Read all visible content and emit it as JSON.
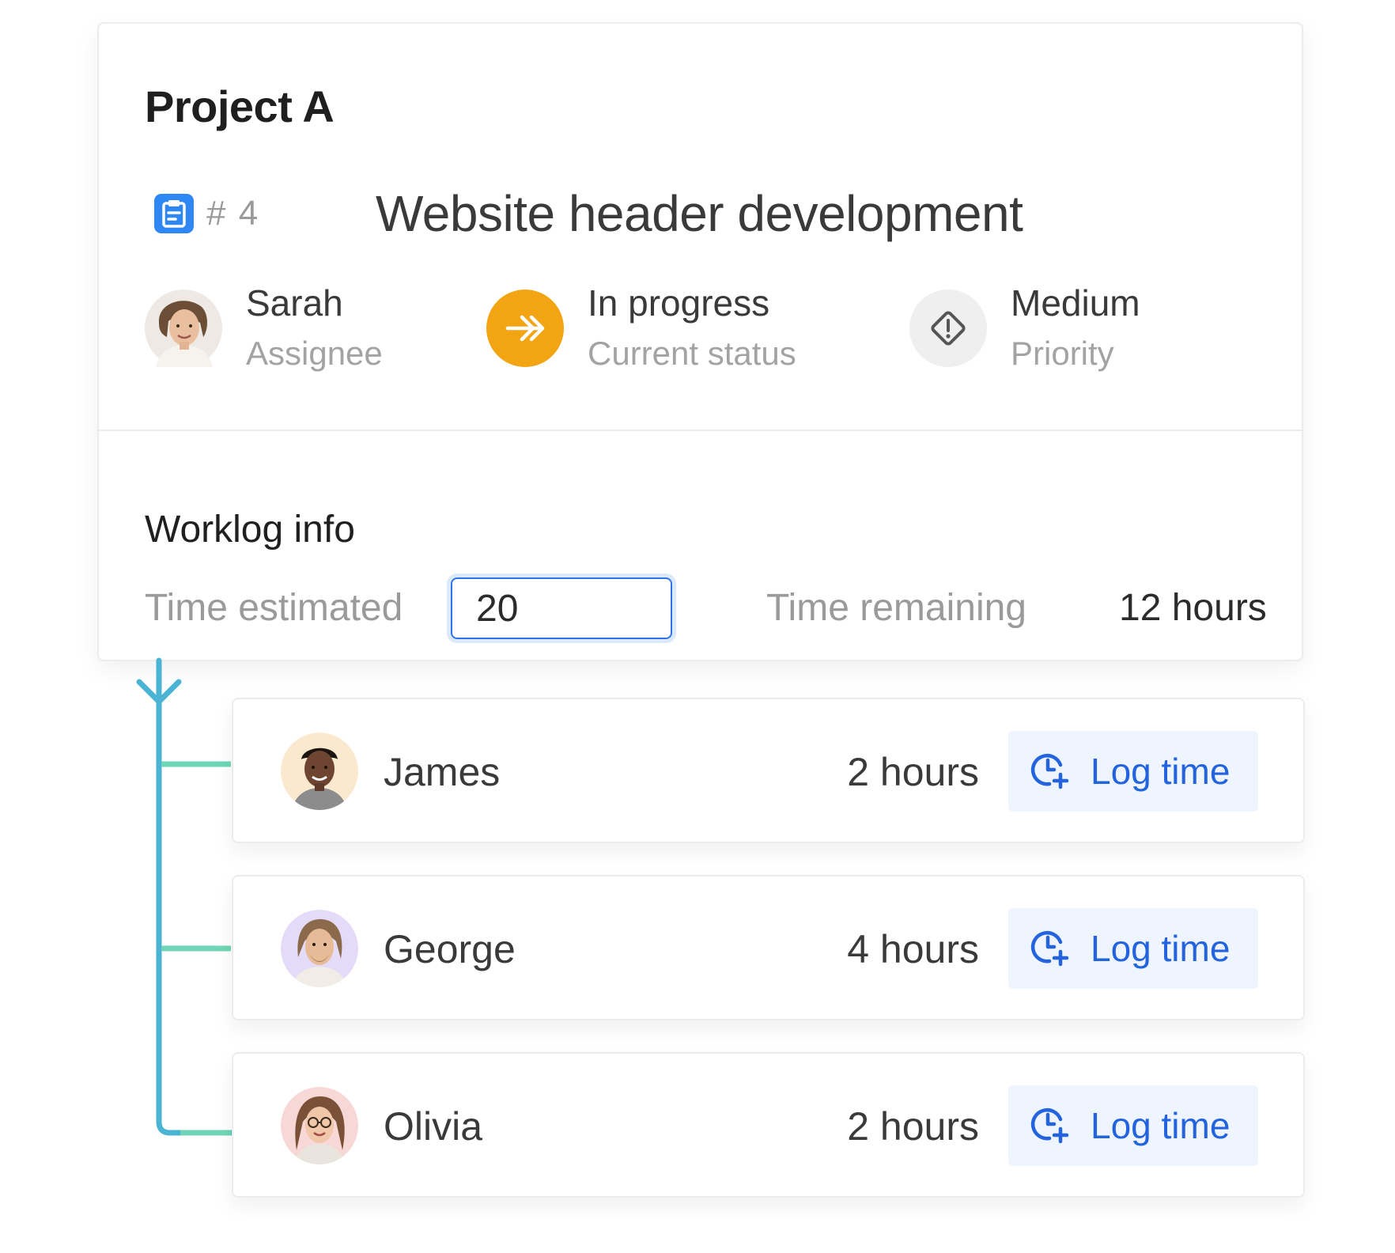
{
  "project": {
    "title": "Project A"
  },
  "task": {
    "id": "# 4",
    "title": "Website header development"
  },
  "meta": {
    "assignee": {
      "name": "Sarah",
      "label": "Assignee"
    },
    "status": {
      "value": "In progress",
      "label": "Current status",
      "color": "#f2a413"
    },
    "priority": {
      "value": "Medium",
      "label": "Priority"
    }
  },
  "worklog": {
    "title": "Worklog info",
    "estimated_label": "Time estimated",
    "estimated_value": "20",
    "remaining_label": "Time remaining",
    "remaining_value": "12 hours"
  },
  "entries": [
    {
      "name": "James",
      "hours": "2 hours",
      "action": "Log time"
    },
    {
      "name": "George",
      "hours": "4 hours",
      "action": "Log time"
    },
    {
      "name": "Olivia",
      "hours": "2 hours",
      "action": "Log time"
    }
  ],
  "colors": {
    "accent": "#2363dd",
    "task_icon": "#2f86f5",
    "connector": "#4bb3d4",
    "branch": "#6ed6b6"
  }
}
